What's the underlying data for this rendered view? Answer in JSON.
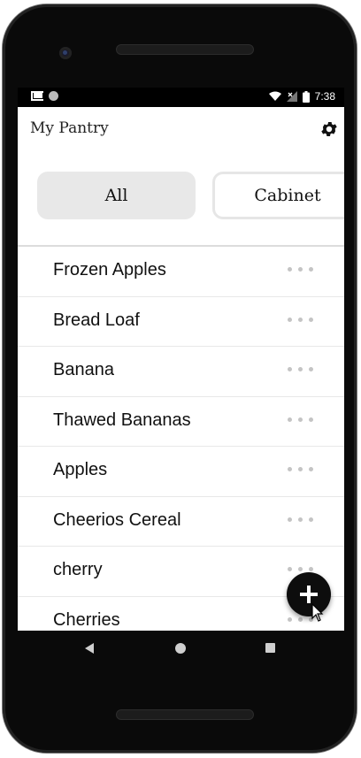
{
  "status_bar": {
    "time": "7:38",
    "icons": [
      "gmail-icon",
      "notification-dot-icon",
      "wifi-icon",
      "no-signal-icon",
      "battery-icon"
    ]
  },
  "app_bar": {
    "title": "My Pantry",
    "settings_icon": "gear-icon"
  },
  "filters": [
    {
      "label": "All",
      "selected": true
    },
    {
      "label": "Cabinet",
      "selected": false
    }
  ],
  "items": [
    {
      "name": "Frozen Apples"
    },
    {
      "name": "Bread Loaf"
    },
    {
      "name": "Banana"
    },
    {
      "name": "Thawed Bananas"
    },
    {
      "name": "Apples"
    },
    {
      "name": "Cheerios Cereal"
    },
    {
      "name": "cherry"
    },
    {
      "name": "Cherries"
    }
  ],
  "row_action_icon": "more-horizontal-icon",
  "fab_icon": "plus-icon",
  "nav_bar": [
    "back-icon",
    "home-icon",
    "recents-icon"
  ],
  "colors": {
    "selected_chip": "#e8e8e8",
    "fab": "#0d0d0d",
    "dots": "#c4c4c4"
  }
}
